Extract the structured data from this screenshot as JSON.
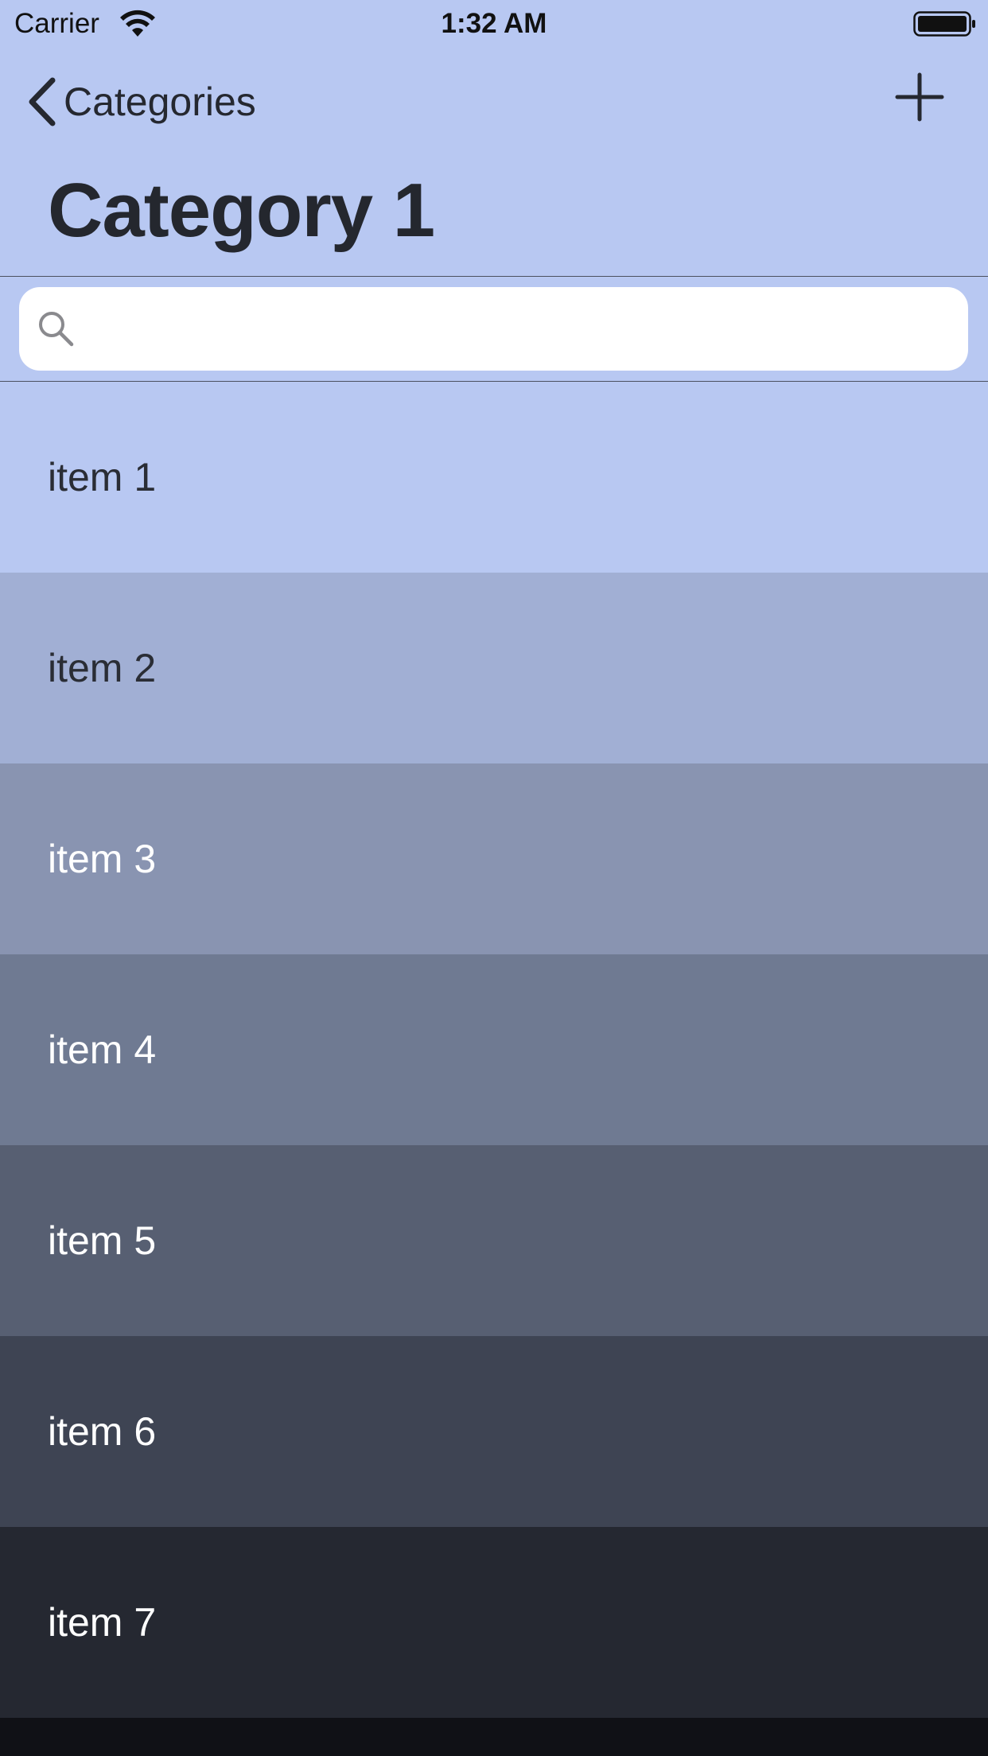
{
  "status_bar": {
    "carrier": "Carrier",
    "time": "1:32 AM",
    "icons": [
      "wifi-icon",
      "battery-icon"
    ]
  },
  "nav": {
    "back_label": "Categories",
    "back_icon": "chevron-left-icon",
    "add_icon": "plus-icon",
    "title": "Category 1"
  },
  "search": {
    "icon": "search-icon",
    "value": "",
    "placeholder": ""
  },
  "colors": {
    "nav_background": "#B8C8F2",
    "title_text": "#24272E"
  },
  "items": [
    {
      "label": "item 1",
      "background": "#B8C8F2",
      "text_color": "#2A2D35"
    },
    {
      "label": "item 2",
      "background": "#A1AFD4",
      "text_color": "#2A2D35"
    },
    {
      "label": "item 3",
      "background": "#8994B1",
      "text_color": "#FFFFFF"
    },
    {
      "label": "item 4",
      "background": "#6F7A92",
      "text_color": "#FFFFFF"
    },
    {
      "label": "item 5",
      "background": "#575F72",
      "text_color": "#FFFFFF"
    },
    {
      "label": "item 6",
      "background": "#3E4453",
      "text_color": "#FFFFFF"
    },
    {
      "label": "item 7",
      "background": "#252831",
      "text_color": "#FFFFFF"
    }
  ]
}
